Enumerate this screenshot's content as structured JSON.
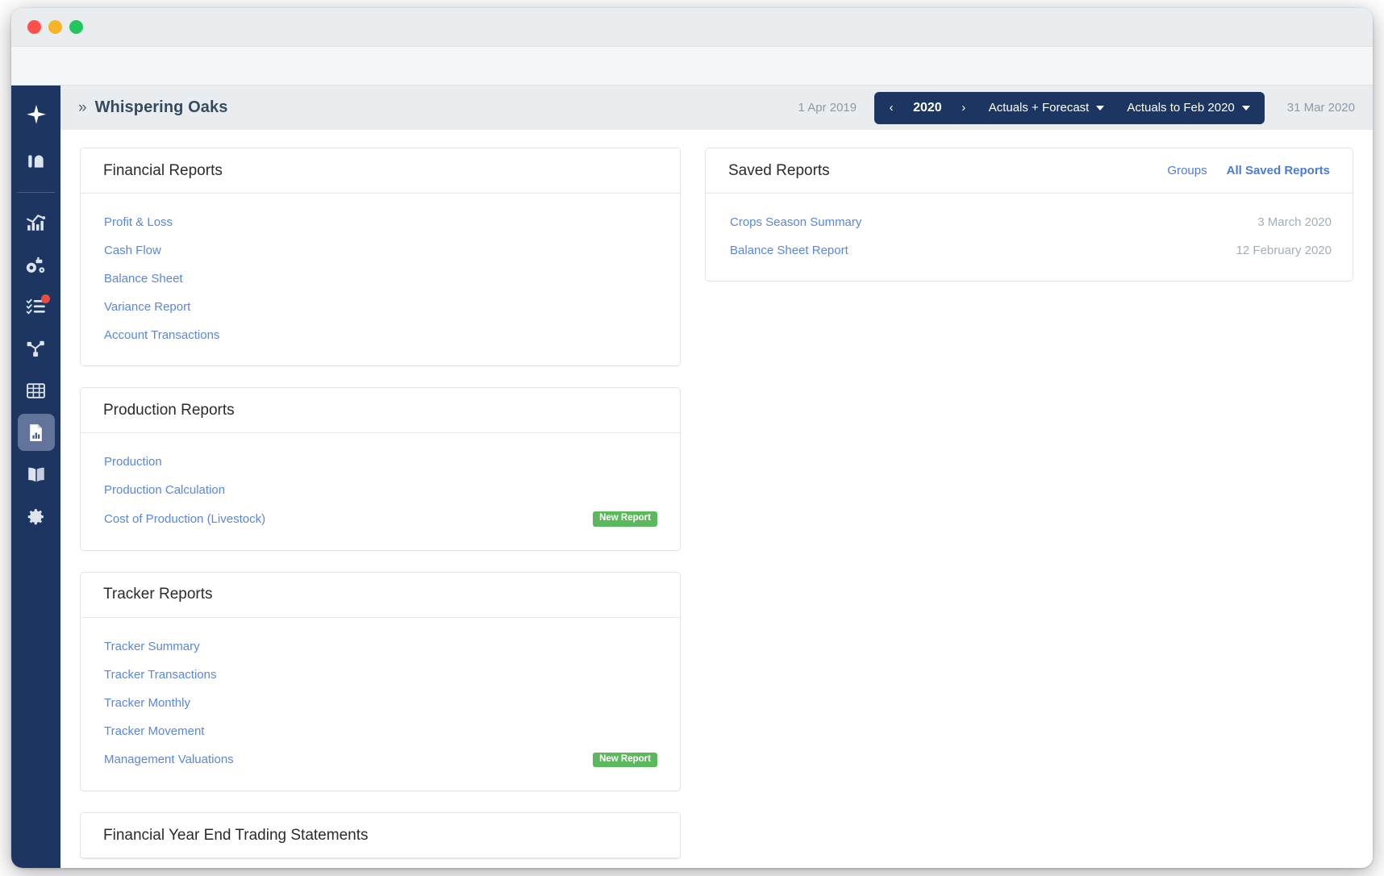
{
  "window": {
    "traffic_lights": [
      "close",
      "minimize",
      "maximize"
    ]
  },
  "sidebar": {
    "items": [
      {
        "name": "brand-logo",
        "icon": "sparkle-icon",
        "active": false,
        "badge": false
      },
      {
        "name": "farm-icon",
        "icon": "barn-icon",
        "active": false,
        "badge": false
      },
      {
        "name": "analytics",
        "icon": "bar-chart-line-icon",
        "active": false,
        "badge": false
      },
      {
        "name": "machinery",
        "icon": "tractor-icon",
        "active": false,
        "badge": false
      },
      {
        "name": "tasks",
        "icon": "checklist-icon",
        "active": false,
        "badge": true
      },
      {
        "name": "workflow",
        "icon": "sitemap-icon",
        "active": false,
        "badge": false
      },
      {
        "name": "spreadsheet",
        "icon": "grid-table-icon",
        "active": false,
        "badge": false
      },
      {
        "name": "reports",
        "icon": "document-chart-icon",
        "active": true,
        "badge": false
      },
      {
        "name": "library",
        "icon": "open-book-icon",
        "active": false,
        "badge": false
      },
      {
        "name": "settings",
        "icon": "gear-icon",
        "active": false,
        "badge": false
      }
    ]
  },
  "header": {
    "breadcrumb_chevrons": "»",
    "title": "Whispering Oaks",
    "start_date": "1 Apr 2019",
    "end_date": "31 Mar 2020",
    "period": {
      "prev_label": "‹",
      "year": "2020",
      "next_label": "›",
      "scenario": "Actuals + Forecast",
      "actuals": "Actuals to Feb 2020"
    }
  },
  "main": {
    "cards": [
      {
        "title": "Financial Reports",
        "rows": [
          {
            "label": "Profit & Loss",
            "badge": null
          },
          {
            "label": "Cash Flow",
            "badge": null
          },
          {
            "label": "Balance Sheet",
            "badge": null
          },
          {
            "label": "Variance Report",
            "badge": null
          },
          {
            "label": "Account Transactions",
            "badge": null
          }
        ]
      },
      {
        "title": "Production Reports",
        "rows": [
          {
            "label": "Production",
            "badge": null
          },
          {
            "label": "Production Calculation",
            "badge": null
          },
          {
            "label": "Cost of Production (Livestock)",
            "badge": "New Report"
          }
        ]
      },
      {
        "title": "Tracker Reports",
        "rows": [
          {
            "label": "Tracker Summary",
            "badge": null
          },
          {
            "label": "Tracker Transactions",
            "badge": null
          },
          {
            "label": "Tracker Monthly",
            "badge": null
          },
          {
            "label": "Tracker Movement",
            "badge": null
          },
          {
            "label": "Management Valuations",
            "badge": "New Report"
          }
        ]
      },
      {
        "title": "Financial Year End Trading Statements",
        "rows": []
      }
    ]
  },
  "saved_reports": {
    "title": "Saved Reports",
    "links": [
      {
        "label": "Groups",
        "strong": false
      },
      {
        "label": "All Saved Reports",
        "strong": true
      }
    ],
    "rows": [
      {
        "label": "Crops Season Summary",
        "date": "3 March 2020"
      },
      {
        "label": "Balance Sheet Report",
        "date": "12 February 2020"
      }
    ]
  },
  "colors": {
    "sidebar": "#1c3661",
    "header_bar": "#e9edf0",
    "link": "#5a87d8",
    "badge_green": "#5cb85c",
    "notification_red": "#ee4b3c"
  }
}
